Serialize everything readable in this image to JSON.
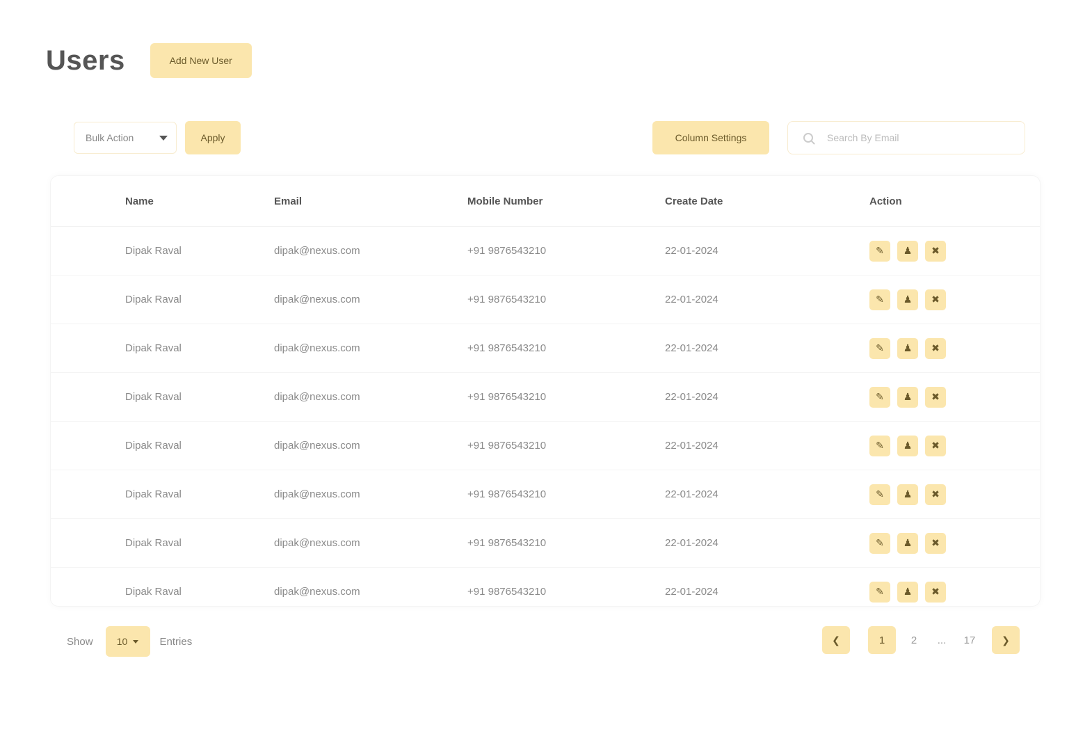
{
  "header": {
    "title": "Users",
    "add_button_label": "Add New User"
  },
  "toolbar": {
    "bulk_action_value": "Bulk Action",
    "apply_label": "Apply",
    "column_settings_label": "Column Settings",
    "search_placeholder": "Search By Email"
  },
  "table": {
    "columns": [
      "Name",
      "Email",
      "Mobile Number",
      "Create Date",
      "Action"
    ],
    "rows": [
      {
        "name": "Dipak Raval",
        "email": "dipak@nexus.com",
        "mobile": "+91 9876543210",
        "date": "22-01-2024"
      },
      {
        "name": "Dipak Raval",
        "email": "dipak@nexus.com",
        "mobile": "+91 9876543210",
        "date": "22-01-2024"
      },
      {
        "name": "Dipak Raval",
        "email": "dipak@nexus.com",
        "mobile": "+91 9876543210",
        "date": "22-01-2024"
      },
      {
        "name": "Dipak Raval",
        "email": "dipak@nexus.com",
        "mobile": "+91 9876543210",
        "date": "22-01-2024"
      },
      {
        "name": "Dipak Raval",
        "email": "dipak@nexus.com",
        "mobile": "+91 9876543210",
        "date": "22-01-2024"
      },
      {
        "name": "Dipak Raval",
        "email": "dipak@nexus.com",
        "mobile": "+91 9876543210",
        "date": "22-01-2024"
      },
      {
        "name": "Dipak Raval",
        "email": "dipak@nexus.com",
        "mobile": "+91 9876543210",
        "date": "22-01-2024"
      },
      {
        "name": "Dipak Raval",
        "email": "dipak@nexus.com",
        "mobile": "+91 9876543210",
        "date": "22-01-2024"
      }
    ],
    "action_icons": [
      "edit-icon",
      "user-icon",
      "delete-icon"
    ]
  },
  "footer": {
    "show_label": "Show",
    "page_size": "10",
    "entries_label": "Entries"
  },
  "pagination": {
    "pages": [
      "1",
      "2",
      "...",
      "17"
    ],
    "active_page": "1"
  },
  "colors": {
    "accent": "#fbe6ad",
    "accent_text": "#6b5a2a"
  }
}
